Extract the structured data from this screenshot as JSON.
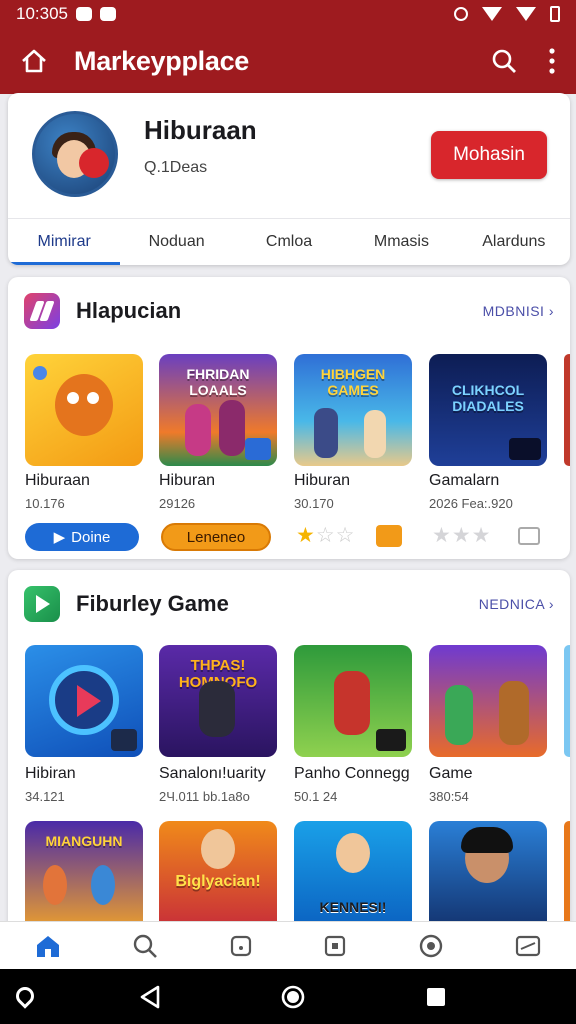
{
  "status_bar": {
    "time": "10:305"
  },
  "app_bar": {
    "title": "Markeypplace"
  },
  "app_card": {
    "name": "Hiburaan",
    "subtitle": "Q.1Deas",
    "install_label": "Mohasin",
    "tabs": [
      {
        "label": "Mimirar",
        "active": true
      },
      {
        "label": "Noduan",
        "active": false
      },
      {
        "label": "Cmloa",
        "active": false
      },
      {
        "label": "Mmasis",
        "active": false
      },
      {
        "label": "Alarduns",
        "active": false
      }
    ]
  },
  "section1": {
    "title": "Hlapucian",
    "more_label": "MDBNISI",
    "items": [
      {
        "name": "Hiburaan",
        "meta": "10.176",
        "tile_text": "",
        "action": {
          "label": "Doine",
          "kind": "pill-blue"
        }
      },
      {
        "name": "Hiburan",
        "meta": "29126",
        "tile_text": "FHRIDAN LOAALS",
        "action": {
          "label": "Leneneo",
          "kind": "pill-orange"
        }
      },
      {
        "name": "Hiburan",
        "meta": "30.170",
        "tile_text": "HIBHGEN GAMES",
        "action": {
          "label": "",
          "kind": "stars-1"
        }
      },
      {
        "name": "Gamalarn",
        "meta": "2026 Fea:.920",
        "tile_text": "CLIKHCOL DIADALES",
        "action": {
          "label": "",
          "kind": "stars-0"
        }
      }
    ]
  },
  "section2": {
    "title": "Fiburley Game",
    "more_label": "NEDNICA",
    "items": [
      {
        "name": "Hibiran",
        "meta": "34.121",
        "tile_text": ""
      },
      {
        "name": "Sanalonı!uarity",
        "meta": "2Ч.011 bb.1a8o",
        "tile_text": "THPAS! HOMNOFO"
      },
      {
        "name": "Panho Connegg",
        "meta": "50.1 24",
        "tile_text": ""
      },
      {
        "name": "Game",
        "meta": "380:54",
        "tile_text": ""
      }
    ],
    "row2_tiles": [
      "MIANGUHN",
      "Biglyacian!",
      "KENNESI!",
      ""
    ]
  },
  "colors": {
    "brand": "#9e1b1f",
    "accent": "#d8262c",
    "link": "#4b4fa8"
  },
  "bottom_nav": [
    "home-icon",
    "search-icon",
    "tablet-icon",
    "box-icon",
    "face-icon",
    "wallet-icon"
  ]
}
